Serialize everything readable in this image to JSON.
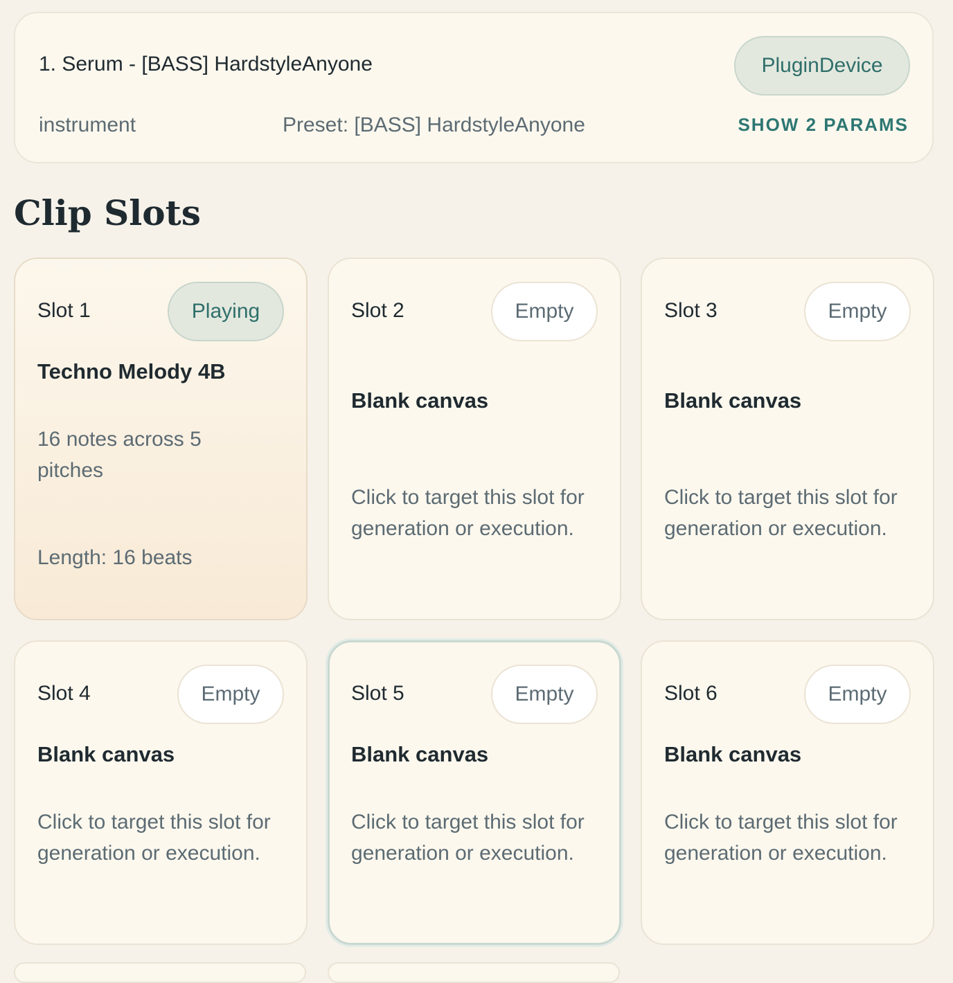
{
  "device": {
    "title": "1. Serum - [BASS] HardstyleAnyone",
    "badge": "PluginDevice",
    "kind": "instrument",
    "preset": "Preset: [BASS] HardstyleAnyone",
    "show_params": "SHOW 2 PARAMS"
  },
  "section_title": "Clip Slots",
  "slots": [
    {
      "label": "Slot 1",
      "status": "Playing",
      "name": "Techno Melody 4B",
      "description": "16 notes across 5 pitches",
      "length": "Length: 16 beats"
    },
    {
      "label": "Slot 2",
      "status": "Empty",
      "name": "Blank canvas",
      "description": "Click to target this slot for generation or execution."
    },
    {
      "label": "Slot 3",
      "status": "Empty",
      "name": "Blank canvas",
      "description": "Click to target this slot for generation or execution."
    },
    {
      "label": "Slot 4",
      "status": "Empty",
      "name": "Blank canvas",
      "description": "Click to target this slot for generation or execution."
    },
    {
      "label": "Slot 5",
      "status": "Empty",
      "name": "Blank canvas",
      "description": "Click to target this slot for generation or execution."
    },
    {
      "label": "Slot 6",
      "status": "Empty",
      "name": "Blank canvas",
      "description": "Click to target this slot for generation or execution."
    }
  ]
}
